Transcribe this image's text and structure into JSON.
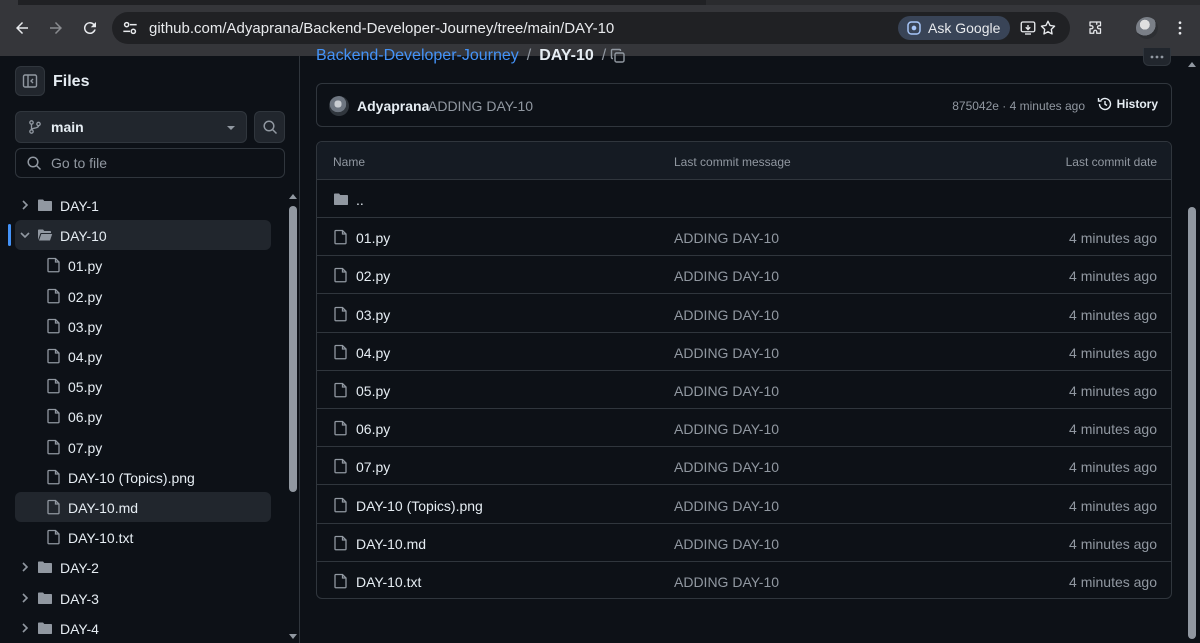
{
  "browser": {
    "url": "github.com/Adyaprana/Backend-Developer-Journey/tree/main/DAY-10",
    "ask_google_label": "Ask Google"
  },
  "sidebar": {
    "title": "Files",
    "branch": "main",
    "go_to_file_placeholder": "Go to file",
    "tree": [
      {
        "label": "DAY-1",
        "type": "folder",
        "expanded": false,
        "depth": 0
      },
      {
        "label": "DAY-10",
        "type": "folder",
        "expanded": true,
        "depth": 0,
        "current": true
      },
      {
        "label": "01.py",
        "type": "file",
        "depth": 1
      },
      {
        "label": "02.py",
        "type": "file",
        "depth": 1
      },
      {
        "label": "03.py",
        "type": "file",
        "depth": 1
      },
      {
        "label": "04.py",
        "type": "file",
        "depth": 1
      },
      {
        "label": "05.py",
        "type": "file",
        "depth": 1
      },
      {
        "label": "06.py",
        "type": "file",
        "depth": 1
      },
      {
        "label": "07.py",
        "type": "file",
        "depth": 1
      },
      {
        "label": "DAY-10 (Topics).png",
        "type": "file",
        "depth": 1
      },
      {
        "label": "DAY-10.md",
        "type": "file",
        "depth": 1,
        "hover": true
      },
      {
        "label": "DAY-10.txt",
        "type": "file",
        "depth": 1
      },
      {
        "label": "DAY-2",
        "type": "folder",
        "expanded": false,
        "depth": 0
      },
      {
        "label": "DAY-3",
        "type": "folder",
        "expanded": false,
        "depth": 0
      },
      {
        "label": "DAY-4",
        "type": "folder",
        "expanded": false,
        "depth": 0
      }
    ]
  },
  "breadcrumb": {
    "repo": "Backend-Developer-Journey",
    "separator": "/",
    "current": "DAY-10",
    "trailing": "/"
  },
  "commit": {
    "author": "Adyaprana",
    "message": "ADDING DAY-10",
    "meta": "875042e · 4 minutes ago",
    "history_label": "History"
  },
  "table": {
    "headers": {
      "name": "Name",
      "message": "Last commit message",
      "date": "Last commit date"
    },
    "parent_label": "..",
    "rows": [
      {
        "name": "01.py",
        "message": "ADDING DAY-10",
        "date": "4 minutes ago"
      },
      {
        "name": "02.py",
        "message": "ADDING DAY-10",
        "date": "4 minutes ago"
      },
      {
        "name": "03.py",
        "message": "ADDING DAY-10",
        "date": "4 minutes ago"
      },
      {
        "name": "04.py",
        "message": "ADDING DAY-10",
        "date": "4 minutes ago"
      },
      {
        "name": "05.py",
        "message": "ADDING DAY-10",
        "date": "4 minutes ago"
      },
      {
        "name": "06.py",
        "message": "ADDING DAY-10",
        "date": "4 minutes ago"
      },
      {
        "name": "07.py",
        "message": "ADDING DAY-10",
        "date": "4 minutes ago"
      },
      {
        "name": "DAY-10 (Topics).png",
        "message": "ADDING DAY-10",
        "date": "4 minutes ago"
      },
      {
        "name": "DAY-10.md",
        "message": "ADDING DAY-10",
        "date": "4 minutes ago"
      },
      {
        "name": "DAY-10.txt",
        "message": "ADDING DAY-10",
        "date": "4 minutes ago"
      }
    ]
  },
  "colors": {
    "background": "#0d1117",
    "border": "#30363d",
    "link": "#4493f8",
    "text": "#e6edf3",
    "muted": "#9198a1",
    "chrome": "#35363a"
  }
}
